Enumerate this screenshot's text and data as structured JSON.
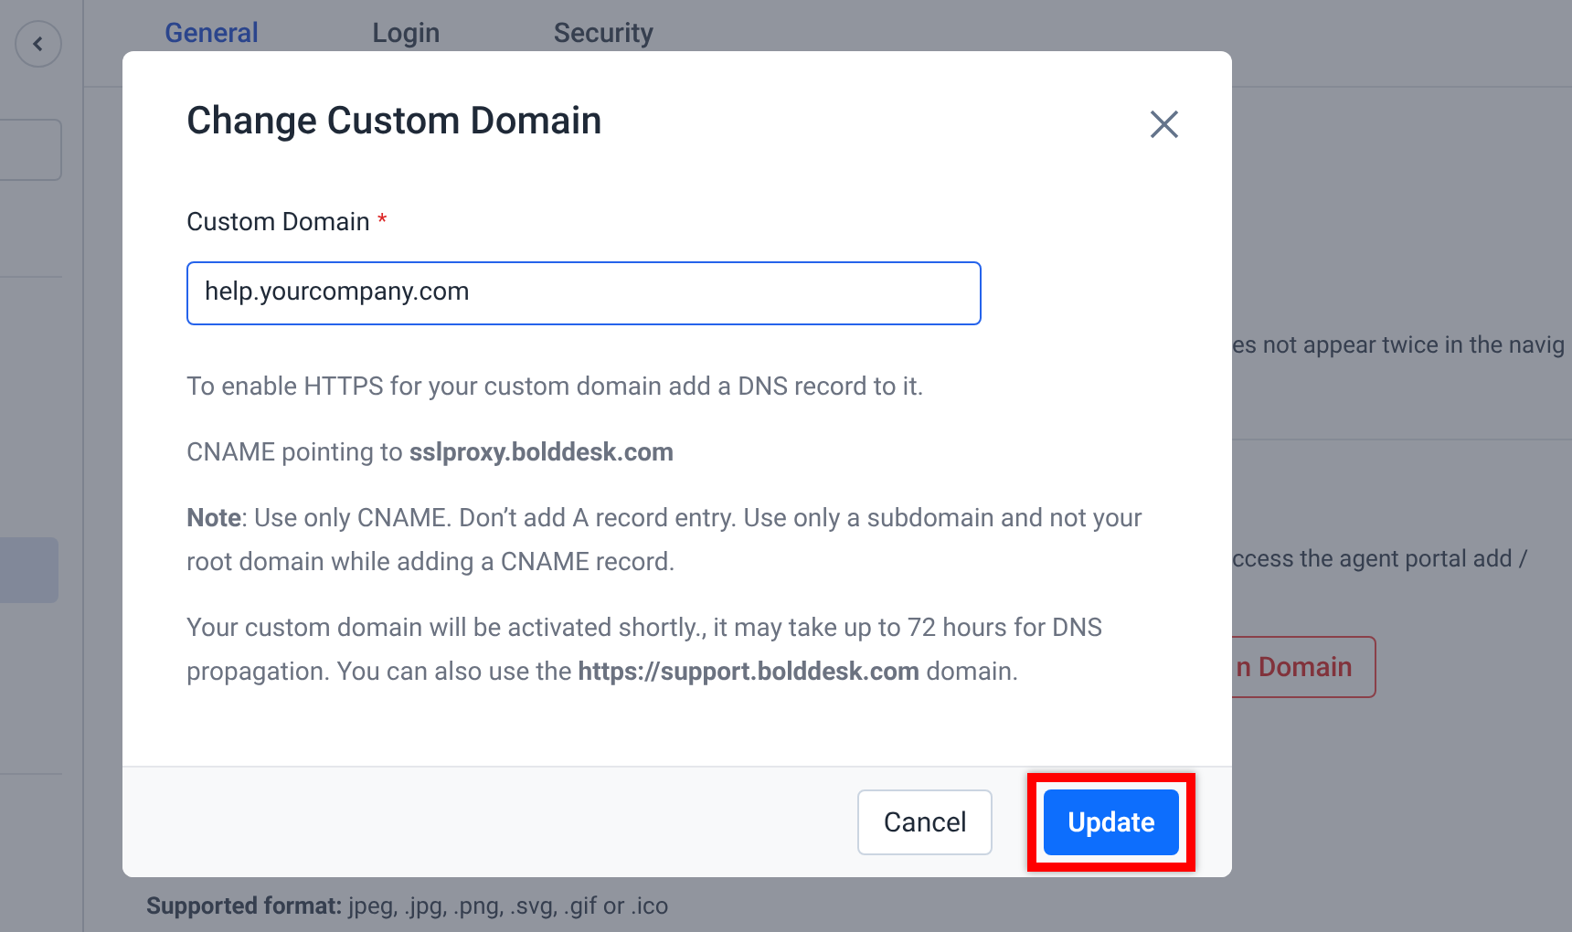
{
  "tabs": [
    {
      "label": "General",
      "selected": true
    },
    {
      "label": "Login",
      "selected": false
    },
    {
      "label": "Security",
      "selected": false
    }
  ],
  "background": {
    "text_1": "es not appear twice in the navig",
    "text_2": "ccess the agent portal add /",
    "button": "n Domain",
    "supported_label": "Supported format:",
    "supported_value": "jpeg, .jpg, .png, .svg, .gif or .ico"
  },
  "dialog": {
    "title": "Change Custom Domain",
    "field": {
      "label": "Custom Domain",
      "required_mark": "*",
      "value": "help.yourcompany.com"
    },
    "paragraphs": [
      "To enable HTTPS for your custom domain add a DNS record to it.",
      "CNAME pointing to **sslproxy.bolddesk.com**",
      "**Note**: Use only CNAME. Don’t add A record entry. Use only a subdomain and not your root domain while adding a CNAME record.",
      "Your custom domain will be activated shortly., it may take up to 72 hours for DNS propagation. You can also use the **https://support.bolddesk.com** domain."
    ],
    "buttons": [
      {
        "label": "Cancel",
        "kind": "secondary",
        "highlighted": false
      },
      {
        "label": "Update",
        "kind": "primary",
        "highlighted": true
      }
    ]
  }
}
